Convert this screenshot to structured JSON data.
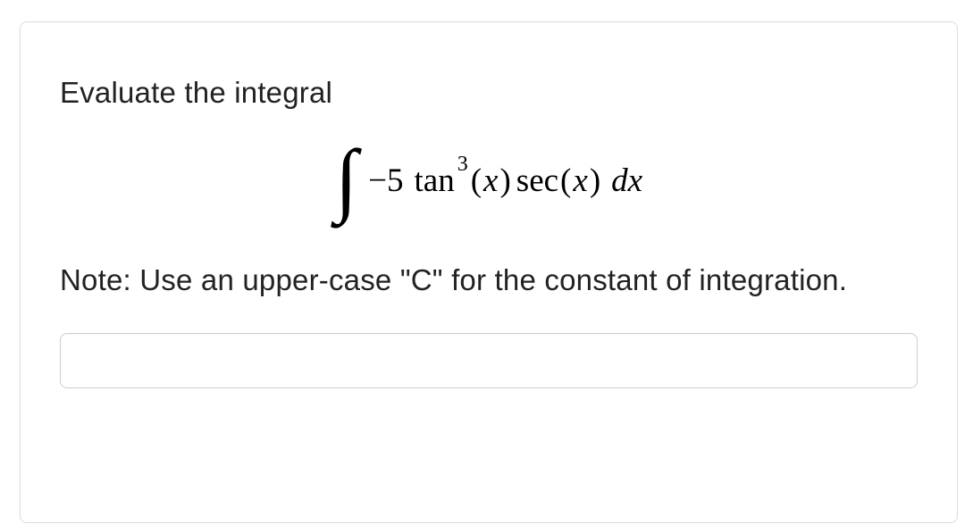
{
  "question": {
    "prompt": "Evaluate the integral",
    "integral": {
      "coefficient": "−5",
      "func1": "tan",
      "power": "3",
      "arg1_open": "(",
      "arg1_var": "x",
      "arg1_close": ")",
      "func2": "sec",
      "arg2_open": "(",
      "arg2_var": "x",
      "arg2_close": ")",
      "dx": "dx"
    },
    "note": "Note: Use an upper-case \"C\" for the constant of integration.",
    "answer_value": ""
  }
}
